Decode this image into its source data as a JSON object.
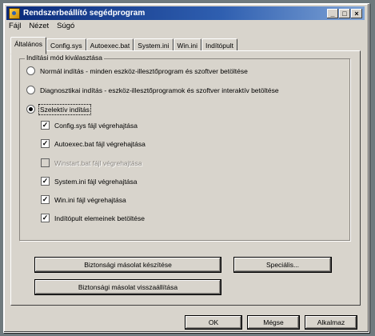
{
  "window": {
    "title": "Rendszerbeállító segédprogram",
    "controls": {
      "minimize": "_",
      "maximize": "□",
      "close": "×"
    }
  },
  "menu": [
    "Fájl",
    "Nézet",
    "Súgó"
  ],
  "tabs": [
    "Általános",
    "Config.sys",
    "Autoexec.bat",
    "System.ini",
    "Win.ini",
    "Indítópult"
  ],
  "active_tab": "Általános",
  "startup_group": {
    "title": "Indítási mód kiválasztása",
    "options": [
      {
        "label": "Normál indítás - minden eszköz-illesztőprogram és szoftver betöltése",
        "selected": false
      },
      {
        "label": "Diagnosztikai indítás - eszköz-illesztőprogramok és szoftver interaktív betöltése",
        "selected": false
      },
      {
        "label": "Szelektív indítás",
        "selected": true
      }
    ],
    "selective_items": [
      {
        "label": "Config.sys fájl végrehajtása",
        "checked": true,
        "enabled": true
      },
      {
        "label": "Autoexec.bat fájl végrehajtása",
        "checked": true,
        "enabled": true
      },
      {
        "label": "Winstart.bat fájl végrehajtása",
        "checked": false,
        "enabled": false
      },
      {
        "label": "System.ini fájl végrehajtása",
        "checked": true,
        "enabled": true
      },
      {
        "label": "Win.ini fájl végrehajtása",
        "checked": true,
        "enabled": true
      },
      {
        "label": "Indítópult elemeinek betöltése",
        "checked": true,
        "enabled": true
      }
    ]
  },
  "buttons": {
    "backup": "Biztonsági másolat készítése",
    "restore": "Biztonsági másolat visszaállítása",
    "advanced": "Speciális...",
    "ok": "OK",
    "cancel": "Mégse",
    "apply": "Alkalmaz"
  }
}
